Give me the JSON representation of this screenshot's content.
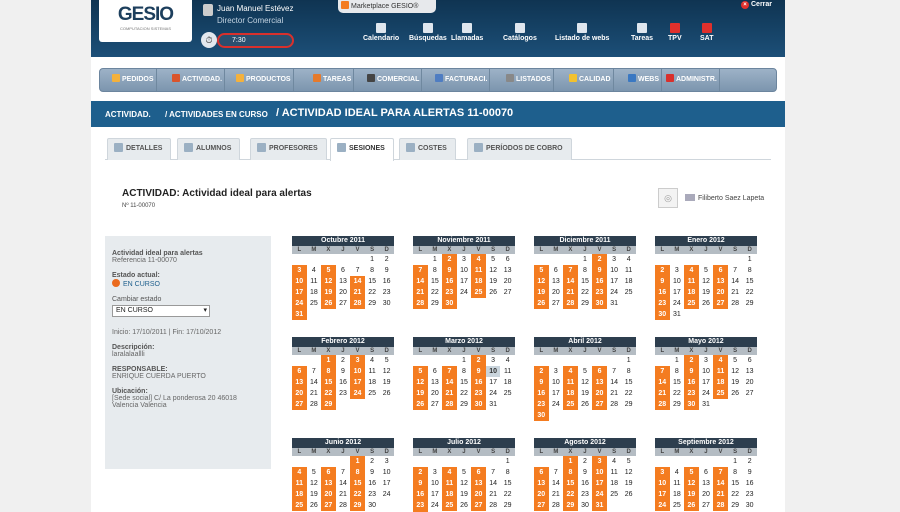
{
  "header": {
    "logo": "GESIO",
    "logo_sub": "COMPUTACION SISTEMAS",
    "user_name": "Juan Manuel Estévez",
    "user_role": "Director Comercial",
    "timer": "7:30",
    "marketplace": "Marketplace GESIO®",
    "close": "Cerrar"
  },
  "topnav": [
    {
      "label": "Calendario",
      "icon": "calendar-icon"
    },
    {
      "label": "Búsquedas",
      "icon": "search-icon"
    },
    {
      "label": "Llamadas",
      "icon": "phone-icon"
    },
    {
      "label": "Catálogos",
      "icon": "catalog-icon"
    },
    {
      "label": "Listado de webs",
      "icon": "web-list-icon"
    },
    {
      "label": "Tareas",
      "icon": "tasks-icon"
    },
    {
      "label": "TPV",
      "icon": "tpv-icon"
    },
    {
      "label": "SAT",
      "icon": "sat-icon"
    }
  ],
  "menu": [
    {
      "label": "PEDIDOS",
      "color": "#f4b13c"
    },
    {
      "label": "ACTIVIDAD.",
      "color": "#d9542c"
    },
    {
      "label": "PRODUCTOS",
      "color": "#f4b13c"
    },
    {
      "label": "TAREAS",
      "color": "#e57a2c"
    },
    {
      "label": "COMERCIAL",
      "color": "#444444"
    },
    {
      "label": "FACTURACI.",
      "color": "#4f7dc2"
    },
    {
      "label": "LISTADOS",
      "color": "#888888"
    },
    {
      "label": "CALIDAD",
      "color": "#f2c12e"
    },
    {
      "label": "WEBS",
      "color": "#3a78c2"
    },
    {
      "label": "ADMINISTR.",
      "color": "#d9302c"
    }
  ],
  "breadcrumb": {
    "a": "ACTIVIDAD.",
    "sep": "/",
    "b": "ACTIVIDADES EN CURSO",
    "c": "ACTIVIDAD IDEAL PARA ALERTAS 11-00070"
  },
  "tabs": [
    "DETALLES",
    "ALUMNOS",
    "PROFESORES",
    "SESIONES",
    "COSTES",
    "PERÍODOS DE COBRO"
  ],
  "activity": {
    "title": "ACTIVIDAD: Actividad ideal para alertas",
    "number": "Nº 11-00070",
    "owner": "Filiberto Saez Lapeta"
  },
  "info": {
    "name": "Actividad ideal para alertas",
    "reference": "Referencia 11-00070",
    "status_label": "Estado actual:",
    "status": "EN CURSO",
    "change_label": "Cambiar estado",
    "change_value": "EN CURSO",
    "dates": "Inicio: 17/10/2011 | Fin: 17/10/2012",
    "desc_label": "Descripción:",
    "desc": "laralalaallli",
    "resp_label": "RESPONSABLE:",
    "resp": "ENRIQUE CUERDA PUERTO",
    "loc_label": "Ubicación:",
    "loc1": "[Sede social] C/ La ponderosa 20 46018",
    "loc2": "Valencia Valencia"
  },
  "weekdays": [
    "L",
    "M",
    "X",
    "J",
    "V",
    "S",
    "D"
  ],
  "months": [
    {
      "name": "Octubre 2011",
      "offset": 5,
      "days": 31,
      "s": [
        3,
        5,
        10,
        12,
        14,
        17,
        19,
        21,
        24,
        26,
        28,
        31
      ]
    },
    {
      "name": "Noviembre 2011",
      "offset": 1,
      "days": 30,
      "s": [
        2,
        4,
        7,
        9,
        11,
        14,
        16,
        18,
        21,
        23,
        25,
        28,
        30
      ],
      "bar": true
    },
    {
      "name": "Diciembre 2011",
      "offset": 3,
      "days": 31,
      "s": [
        2,
        5,
        7,
        9,
        12,
        14,
        16,
        19,
        21,
        23,
        26,
        28,
        30
      ]
    },
    {
      "name": "Enero 2012",
      "offset": 6,
      "days": 31,
      "s": [
        2,
        4,
        6,
        9,
        11,
        13,
        16,
        18,
        20,
        23,
        25,
        27,
        30
      ]
    },
    {
      "name": "Febrero 2012",
      "offset": 2,
      "days": 29,
      "s": [
        1,
        3,
        6,
        8,
        10,
        13,
        15,
        17,
        20,
        22,
        24,
        27,
        29
      ],
      "bar2": true
    },
    {
      "name": "Marzo 2012",
      "offset": 3,
      "days": 31,
      "s": [
        2,
        5,
        7,
        9,
        12,
        14,
        16,
        19,
        21,
        23,
        26,
        28,
        30
      ],
      "t": [
        10
      ]
    },
    {
      "name": "Abril 2012",
      "offset": 6,
      "days": 30,
      "s": [
        2,
        4,
        6,
        9,
        11,
        13,
        16,
        18,
        20,
        23,
        25,
        27,
        30
      ],
      "bar3": true
    },
    {
      "name": "Mayo 2012",
      "offset": 1,
      "days": 31,
      "s": [
        2,
        4,
        7,
        9,
        11,
        14,
        16,
        18,
        21,
        23,
        25,
        28,
        30
      ]
    },
    {
      "name": "Junio 2012",
      "offset": 4,
      "days": 30,
      "s": [
        1,
        4,
        6,
        8,
        11,
        13,
        15,
        18,
        20,
        22,
        25,
        27,
        29
      ]
    },
    {
      "name": "Julio 2012",
      "offset": 6,
      "days": 31,
      "s": [
        2,
        4,
        6,
        9,
        11,
        13,
        16,
        18,
        20,
        23,
        25,
        27,
        30
      ]
    },
    {
      "name": "Agosto 2012",
      "offset": 2,
      "days": 31,
      "s": [
        1,
        3,
        6,
        8,
        10,
        13,
        15,
        17,
        20,
        22,
        24,
        27,
        29,
        31
      ]
    },
    {
      "name": "Septiembre 2012",
      "offset": 5,
      "days": 30,
      "s": [
        3,
        5,
        7,
        10,
        12,
        14,
        17,
        19,
        21,
        24,
        26,
        28
      ]
    }
  ]
}
